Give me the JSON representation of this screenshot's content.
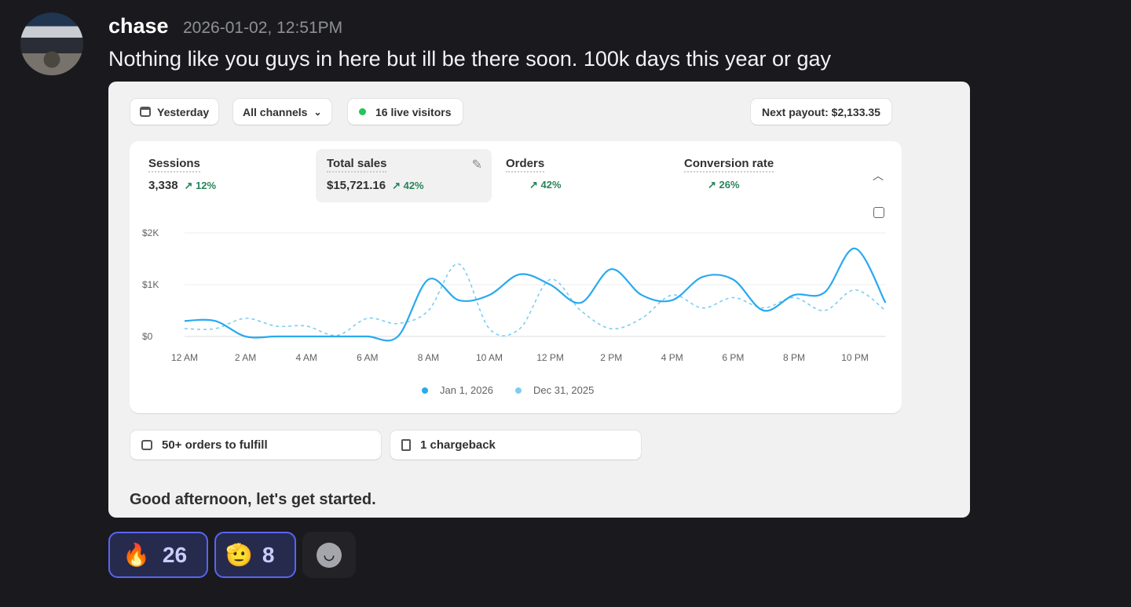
{
  "message": {
    "username": "chase",
    "timestamp": "2026-01-02, 12:51PM",
    "text": "Nothing like you guys in here but ill be there soon. 100k days this year or gay"
  },
  "dashboard": {
    "date_filter": "Yesterday",
    "channel_filter": "All channels",
    "live_visitors": "16 live visitors",
    "next_payout": "Next payout: $2,133.35",
    "metrics": [
      {
        "title": "Sessions",
        "value": "3,338",
        "change": "12%"
      },
      {
        "title": "Total sales",
        "value": "$15,721.16",
        "change": "42%"
      },
      {
        "title": "Orders",
        "value": "",
        "change": "42%"
      },
      {
        "title": "Conversion rate",
        "value": "",
        "change": "26%"
      }
    ],
    "tasks": [
      "50+ orders to fulfill",
      "1 chargeback"
    ],
    "greeting": "Good afternoon, let's get started.",
    "colors": {
      "current": "#29a9f0",
      "previous": "#7dcdf0",
      "live": "#22c55e",
      "up": "#29845a"
    }
  },
  "chart_data": {
    "type": "line",
    "x": [
      0,
      1,
      2,
      3,
      4,
      5,
      6,
      7,
      8,
      9,
      10,
      11,
      12,
      13,
      14,
      15,
      16,
      17,
      18,
      19,
      20,
      21,
      22,
      23
    ],
    "xticks": [
      "12 AM",
      "2 AM",
      "4 AM",
      "6 AM",
      "8 AM",
      "10 AM",
      "12 PM",
      "2 PM",
      "4 PM",
      "6 PM",
      "8 PM",
      "10 PM"
    ],
    "yticks": [
      "$0",
      "$1K",
      "$2K"
    ],
    "ylim": [
      0,
      2000
    ],
    "series": [
      {
        "name": "Jan 1, 2026",
        "style": "solid",
        "values": [
          300,
          300,
          0,
          0,
          0,
          0,
          0,
          0,
          1100,
          700,
          800,
          1200,
          1000,
          650,
          1300,
          800,
          700,
          1150,
          1100,
          500,
          800,
          850,
          1700,
          650
        ]
      },
      {
        "name": "Dec 31, 2025",
        "style": "dashed",
        "values": [
          150,
          150,
          350,
          200,
          200,
          20,
          350,
          250,
          500,
          1400,
          150,
          150,
          1100,
          500,
          150,
          350,
          800,
          550,
          750,
          550,
          750,
          500,
          900,
          500
        ]
      }
    ],
    "legend": "bottom"
  },
  "reactions": [
    {
      "emoji": "🔥",
      "count": "26"
    },
    {
      "emoji": "🫡",
      "count": "8"
    }
  ]
}
